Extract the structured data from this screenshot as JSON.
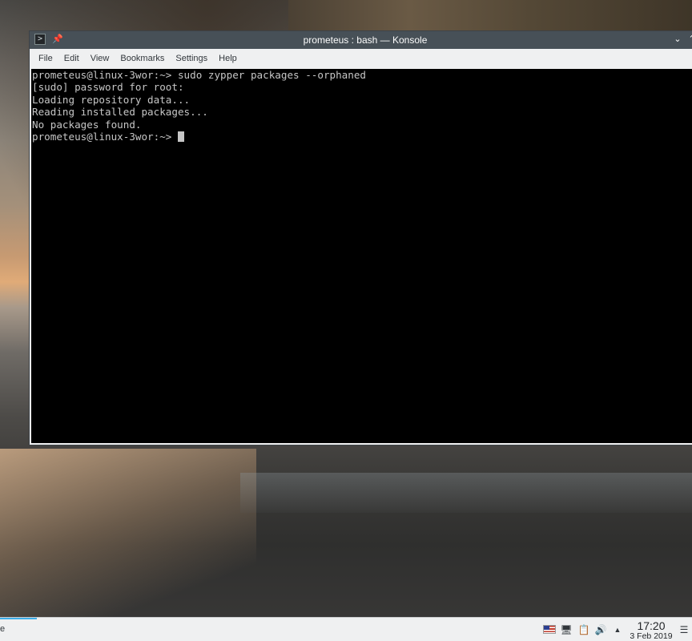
{
  "window": {
    "title": "prometeus : bash — Konsole",
    "app_icon": "konsole-terminal-icon",
    "pin_icon": "pin-icon",
    "controls": [
      "minimize-chevron-icon",
      "maximize-icon"
    ]
  },
  "menubar": {
    "items": [
      "File",
      "Edit",
      "View",
      "Bookmarks",
      "Settings",
      "Help"
    ]
  },
  "terminal": {
    "lines": [
      "prometeus@linux-3wor:~> sudo zypper packages --orphaned",
      "[sudo] password for root:",
      "Loading repository data...",
      "Reading installed packages...",
      "No packages found."
    ],
    "prompt": "prometeus@linux-3wor:~> "
  },
  "taskbar": {
    "task_label": "e",
    "tray_icons": [
      "us-flag-icon",
      "network-icon",
      "clipboard-icon",
      "volume-icon",
      "expand-tray-icon"
    ],
    "clock": {
      "time": "17:20",
      "date": "3 Feb 2019"
    },
    "menu_icon": "hamburger-icon"
  },
  "colors": {
    "titlebar": "#475057",
    "terminal_bg": "#000000",
    "terminal_fg": "#c6c6c6",
    "accent": "#3daee9"
  }
}
